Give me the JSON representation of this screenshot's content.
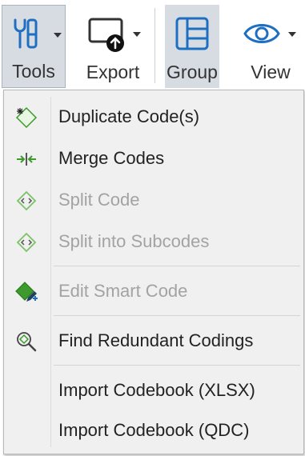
{
  "ribbon": {
    "tools": {
      "label": "Tools",
      "icon": "tools-icon"
    },
    "export": {
      "label": "Export",
      "icon": "export-icon"
    },
    "group": {
      "label": "Group",
      "icon": "group-icon"
    },
    "view": {
      "label": "View",
      "icon": "eye-icon"
    }
  },
  "menu": {
    "items": [
      {
        "label": "Duplicate Code(s)",
        "icon": "duplicate-code-icon",
        "enabled": true
      },
      {
        "label": "Merge Codes",
        "icon": "merge-codes-icon",
        "enabled": true
      },
      {
        "label": "Split Code",
        "icon": "split-code-icon",
        "enabled": false
      },
      {
        "label": "Split into Subcodes",
        "icon": "split-subcodes-icon",
        "enabled": false
      },
      {
        "label": "Edit Smart Code",
        "icon": "edit-smart-code-icon",
        "enabled": false
      },
      {
        "label": "Find Redundant Codings",
        "icon": "find-redundant-icon",
        "enabled": true
      },
      {
        "label": "Import Codebook (XLSX)",
        "icon": "",
        "enabled": true
      },
      {
        "label": "Import Codebook (QDC)",
        "icon": "",
        "enabled": true
      }
    ]
  },
  "colors": {
    "accent_blue": "#1e6fc1",
    "icon_green": "#3d9a2c",
    "disabled_text": "#a3a3a3"
  }
}
